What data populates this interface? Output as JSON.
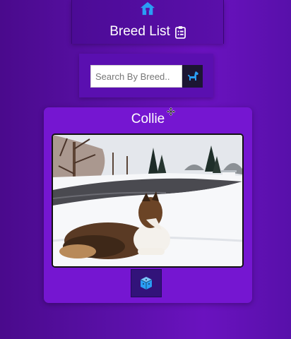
{
  "header": {
    "title": "Breed List",
    "home_icon": "home-icon",
    "list_icon": "clipboard-list-icon"
  },
  "search": {
    "placeholder": "Search By Breed..",
    "value": "",
    "button_icon": "dog-icon"
  },
  "card": {
    "breed_name": "Collie",
    "image_alt": "Collie lying in snow beside a pond",
    "random_button_icon": "cube-icon"
  },
  "colors": {
    "accent": "#2a9df4",
    "card_background": "#7516d1",
    "page_background": "#5a10a8"
  }
}
